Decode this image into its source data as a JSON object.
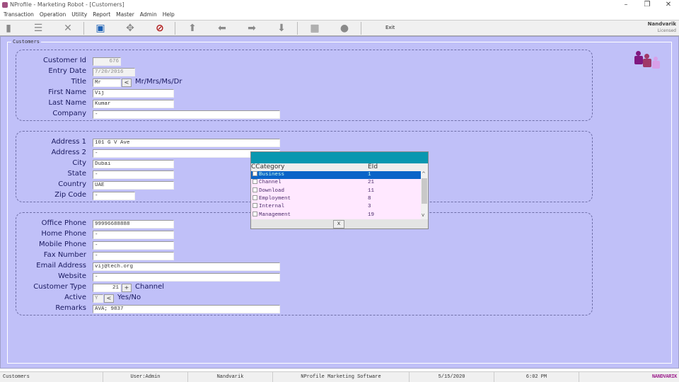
{
  "window": {
    "title": "NProfile - Marketing Robot - [Customers]"
  },
  "menu": [
    "Transaction",
    "Operation",
    "Utility",
    "Report",
    "Master",
    "Admin",
    "Help"
  ],
  "toolbar": {
    "exit_label": "Exit",
    "brand": "Nandvarik",
    "license": "Licensed"
  },
  "form": {
    "group_label": "Customers",
    "customer_id": {
      "label": "Customer Id",
      "value": "676"
    },
    "entry_date": {
      "label": "Entry Date",
      "value": "7/20/2016"
    },
    "title": {
      "label": "Title",
      "value": "Mr",
      "button": "<",
      "hint": "Mr/Mrs/Ms/Dr"
    },
    "first_name": {
      "label": "First Name",
      "value": "Vij"
    },
    "last_name": {
      "label": "Last Name",
      "value": "Kumar"
    },
    "company": {
      "label": "Company",
      "value": "-"
    },
    "address1": {
      "label": "Address 1",
      "value": "101 G V Ave"
    },
    "address2": {
      "label": "Address 2",
      "value": "-"
    },
    "city": {
      "label": "City",
      "value": "Dubai"
    },
    "state": {
      "label": "State",
      "value": "-"
    },
    "country": {
      "label": "Country",
      "value": "UAE"
    },
    "zip": {
      "label": "Zip Code",
      "value": "-"
    },
    "office_phone": {
      "label": "Office Phone",
      "value": "99996688888"
    },
    "home_phone": {
      "label": "Home Phone",
      "value": "-"
    },
    "mobile_phone": {
      "label": "Mobile Phone",
      "value": "-"
    },
    "fax": {
      "label": "Fax Number",
      "value": "-"
    },
    "email": {
      "label": "Email Address",
      "value": "vij@tech.org"
    },
    "website": {
      "label": "Website",
      "value": "-"
    },
    "customer_type": {
      "label": "Customer Type",
      "value": "21",
      "button": "+",
      "hint": "Channel"
    },
    "active": {
      "label": "Active",
      "value": "Y",
      "button": "<",
      "hint": "Yes/No"
    },
    "remarks": {
      "label": "Remarks",
      "value": "AVA; 9837"
    }
  },
  "popup": {
    "col1": "CCategory",
    "col2": "EId",
    "close": "x",
    "rows": [
      {
        "name": "Business",
        "id": "1"
      },
      {
        "name": "Channel",
        "id": "21"
      },
      {
        "name": "Download",
        "id": "11"
      },
      {
        "name": "Employment",
        "id": "8"
      },
      {
        "name": "Internal",
        "id": "3"
      },
      {
        "name": "Management",
        "id": "19"
      }
    ]
  },
  "status": {
    "form": "Customers",
    "user": "User:Admin",
    "company": "Nandvarik",
    "product": "NProfile Marketing Software",
    "date": "5/15/2020",
    "time": "6:02 PM",
    "logo": "NANDVARIK"
  },
  "colors": {
    "background": "#c0c0f8",
    "popup_header": "#0897b0",
    "selection": "#0a64c8"
  }
}
